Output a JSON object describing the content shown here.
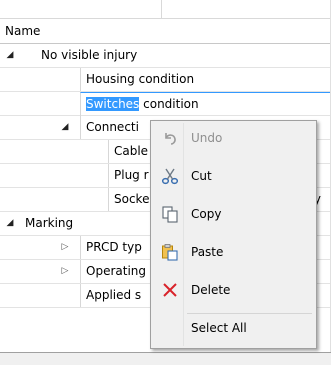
{
  "header": {
    "column_name": "Name"
  },
  "tree": {
    "rows": [
      {
        "label": "No visible injury",
        "expander": "expanded"
      },
      {
        "label": "Housing condition"
      },
      {
        "label_selected": "Switches",
        "label_rest": " condition"
      },
      {
        "label": "Connecti",
        "expander": "expanded"
      },
      {
        "label": "Cable"
      },
      {
        "label": "Plug r"
      },
      {
        "label": "Socke",
        "tail": "ry"
      },
      {
        "label": "Marking",
        "expander": "expanded"
      },
      {
        "label": "PRCD typ",
        "expander": "collapsed"
      },
      {
        "label": "Operating",
        "expander": "collapsed"
      },
      {
        "label": "Applied s"
      }
    ]
  },
  "context_menu": {
    "items": [
      {
        "label": "Undo",
        "icon": "undo-icon",
        "enabled": false
      },
      {
        "label": "Cut",
        "icon": "scissors-icon",
        "enabled": true
      },
      {
        "label": "Copy",
        "icon": "copy-icon",
        "enabled": true
      },
      {
        "label": "Paste",
        "icon": "paste-icon",
        "enabled": true
      },
      {
        "label": "Delete",
        "icon": "delete-icon",
        "enabled": true
      },
      {
        "label": "Select All",
        "icon": "",
        "enabled": true
      }
    ]
  },
  "glyphs": {
    "expanded": "◢",
    "collapsed": "▷"
  },
  "colors": {
    "selection": "#3399ff",
    "delete_icon": "#d9232a",
    "menu_bg": "#f0f0f0"
  }
}
